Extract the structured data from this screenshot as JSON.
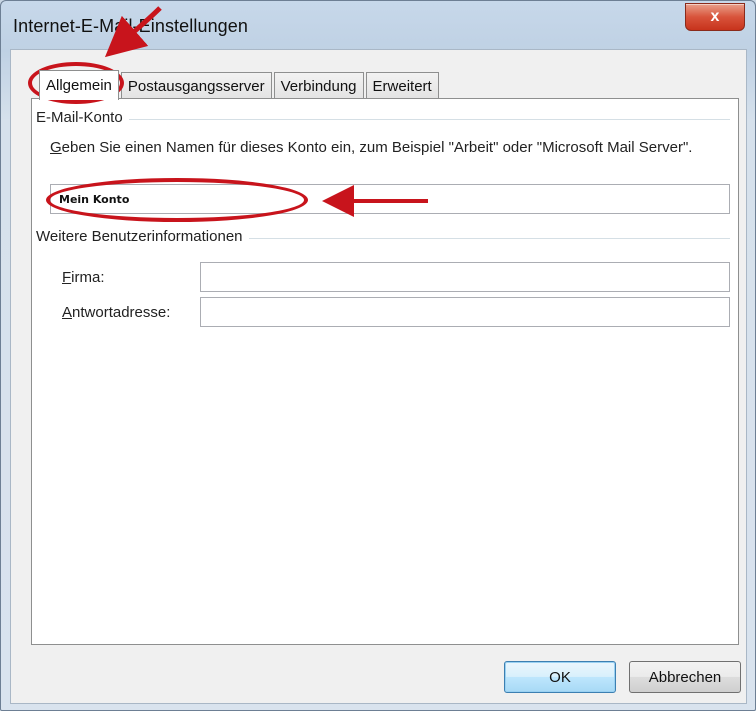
{
  "window": {
    "title": "Internet-E-Mail-Einstellungen",
    "close_glyph": "x",
    "close_icon": "close-icon"
  },
  "tabs": [
    {
      "label": "Allgemein",
      "active": true
    },
    {
      "label": "Postausgangsserver",
      "active": false
    },
    {
      "label": "Verbindung",
      "active": false
    },
    {
      "label": "Erweitert",
      "active": false
    }
  ],
  "account_group": {
    "title": "E-Mail-Konto",
    "hint_accel": "G",
    "hint_rest": "eben Sie einen Namen für dieses Konto ein, zum Beispiel \"Arbeit\" oder \"Microsoft Mail Server\".",
    "account_name_value": "Mein Konto"
  },
  "user_group": {
    "title": "Weitere Benutzerinformationen",
    "company_accel": "F",
    "company_rest": "irma:",
    "company_value": "",
    "reply_accel": "A",
    "reply_rest": "ntwortadresse:",
    "reply_value": ""
  },
  "buttons": {
    "ok": "OK",
    "cancel": "Abbrechen"
  },
  "annotations": {
    "color": "#c8141c"
  }
}
